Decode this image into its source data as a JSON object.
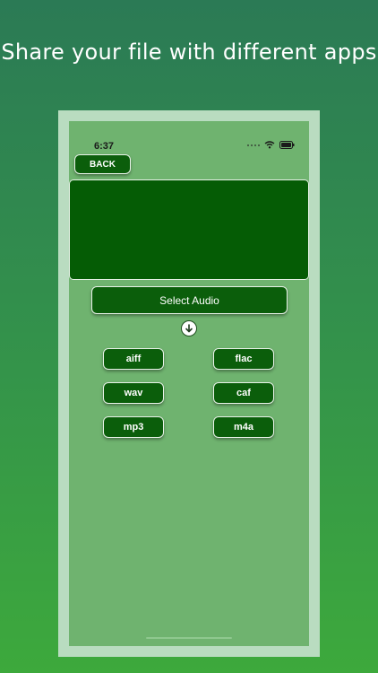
{
  "headline": "Share your file with different apps",
  "status": {
    "time": "6:37"
  },
  "buttons": {
    "back": "BACK",
    "select_audio": "Select Audio"
  },
  "formats": [
    "aiff",
    "flac",
    "wav",
    "caf",
    "mp3",
    "m4a"
  ],
  "colors": {
    "background_top": "#2b7a55",
    "background_bottom": "#3da93c",
    "screen": "#6fb36f",
    "button": "#0b5e0b"
  },
  "icons": {
    "status": [
      "signal-dots-icon",
      "wifi-icon",
      "battery-icon"
    ],
    "arrow": "arrow-down-circle-icon"
  }
}
